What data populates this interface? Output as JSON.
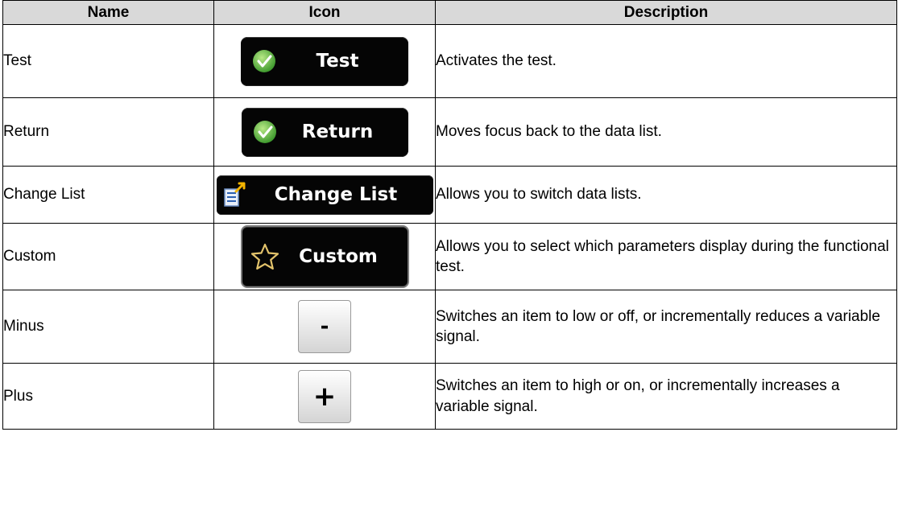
{
  "headers": {
    "name": "Name",
    "icon": "Icon",
    "description": "Description"
  },
  "rows": [
    {
      "name": "Test",
      "icon_label": "Test",
      "icon": "check-icon",
      "description": "Activates the test."
    },
    {
      "name": "Return",
      "icon_label": "Return",
      "icon": "check-icon",
      "description": "Moves focus back to the data list."
    },
    {
      "name": "Change List",
      "icon_label": "Change List",
      "icon": "list-icon",
      "description": "Allows you to switch data lists."
    },
    {
      "name": "Custom",
      "icon_label": "Custom",
      "icon": "star-icon",
      "description": "Allows you to select which parameters display during the functional test."
    },
    {
      "name": "Minus",
      "icon_label": "-",
      "icon": "minus-icon",
      "description": "Switches an item to low or off, or incrementally reduces a variable signal."
    },
    {
      "name": "Plus",
      "icon_label": "+",
      "icon": "plus-icon",
      "description": "Switches an item to high or on, or incrementally increases a variable signal."
    }
  ],
  "colors": {
    "header_bg": "#d9d9d9",
    "button_bg": "#050505",
    "check_green": "#5cb85c"
  }
}
